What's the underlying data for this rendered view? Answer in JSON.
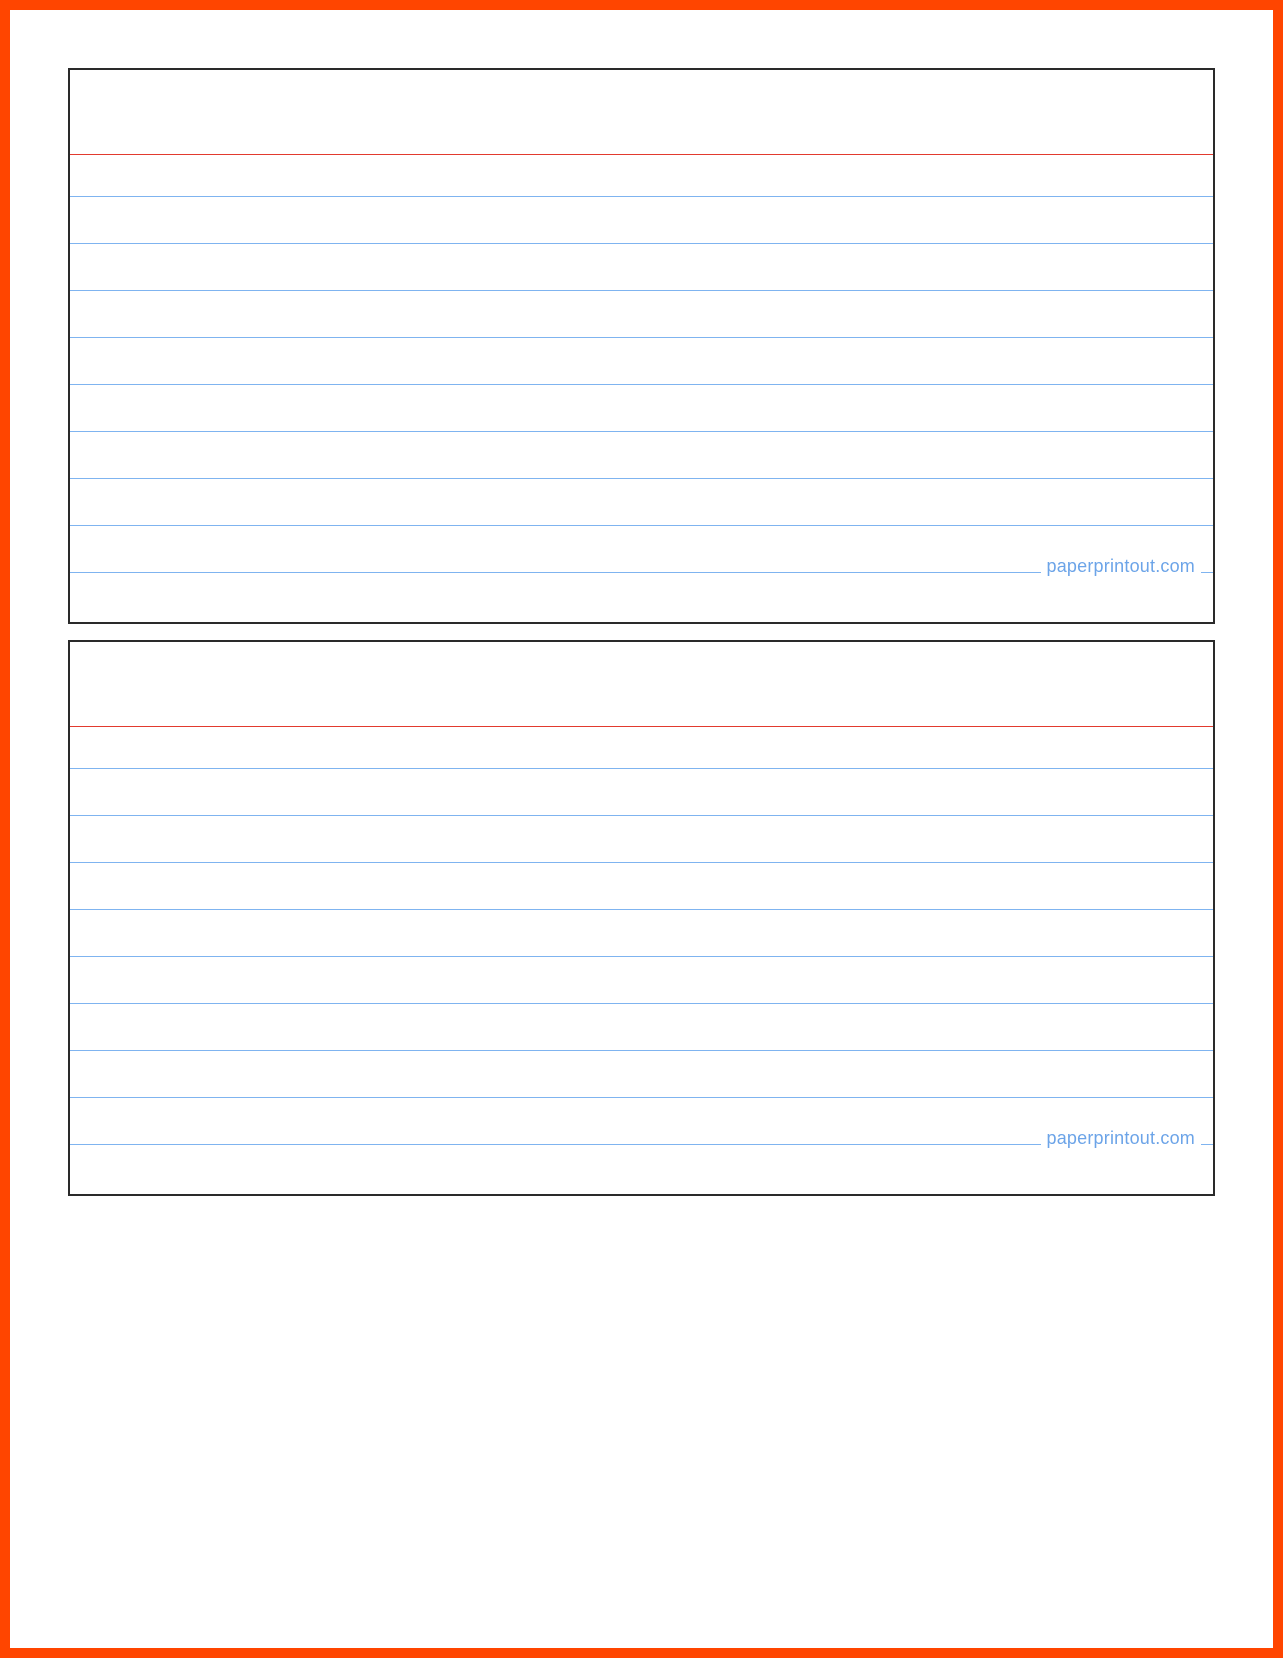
{
  "cards": [
    {
      "watermark": "paperprintout.com"
    },
    {
      "watermark": "paperprintout.com"
    }
  ]
}
